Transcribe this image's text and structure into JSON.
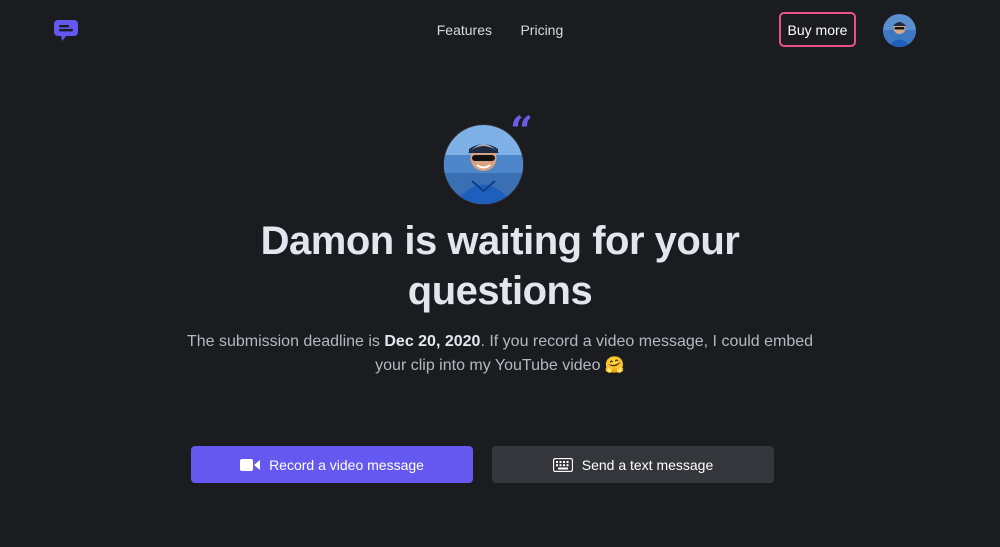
{
  "nav": {
    "links": [
      "Features",
      "Pricing"
    ],
    "buy_label": "Buy more"
  },
  "hero": {
    "headline_line1": "Damon is waiting for your",
    "headline_line2": "questions",
    "sub_prefix": "The submission deadline is ",
    "sub_deadline": "Dec 20, 2020",
    "sub_suffix": ". If you record a video message, I could embed your clip into my YouTube video",
    "emoji": "🤗"
  },
  "actions": {
    "record_label": "Record a video message",
    "text_label": "Send a text message"
  },
  "colors": {
    "background": "#1b1c1f",
    "accent": "#6458f0",
    "buy_border": "#e8518e",
    "secondary_button": "#34363c"
  },
  "icons": {
    "logo": "chat-bubble-icon",
    "record": "video-camera-icon",
    "text": "keyboard-icon"
  }
}
